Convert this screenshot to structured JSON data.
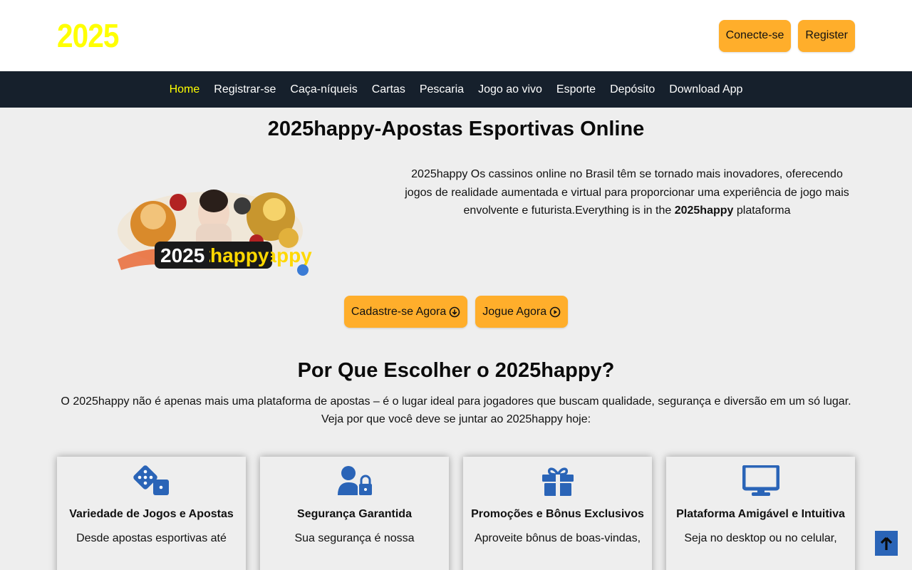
{
  "header": {
    "logo": "2025",
    "login_label": "Conecte-se",
    "register_label": "Register"
  },
  "nav": {
    "items": [
      "Home",
      "Registrar-se",
      "Caça-níqueis",
      "Cartas",
      "Pescaria",
      "Jogo ao vivo",
      "Esporte",
      "Depósito",
      "Download App"
    ]
  },
  "hero": {
    "title": "2025happy-Apostas Esportivas Online",
    "image_text": "2025happy",
    "text_before": "2025happy Os cassinos online no Brasil têm se tornado mais inovadores, oferecendo jogos de realidade aumentada e virtual para proporcionar uma experiência de jogo mais envolvente e futurista.Everything is in the ",
    "text_bold": "2025happy",
    "text_after": " plataforma",
    "cta_register": "Cadastre-se Agora",
    "cta_play": "Jogue Agora"
  },
  "why": {
    "title": "Por Que Escolher o 2025happy?",
    "text": "O 2025happy não é apenas mais uma plataforma de apostas – é o lugar ideal para jogadores que buscam qualidade, segurança e diversão em um só lugar. Veja por que você deve se juntar ao 2025happy hoje:"
  },
  "cards": [
    {
      "icon": "dice-icon",
      "title": "Variedade de Jogos e Apostas",
      "text": "Desde apostas esportivas até"
    },
    {
      "icon": "user-lock-icon",
      "title": "Segurança Garantida",
      "text": "Sua segurança é nossa"
    },
    {
      "icon": "gift-icon",
      "title": "Promoções e Bônus Exclusivos",
      "text": "Aproveite bônus de boas-vindas,"
    },
    {
      "icon": "desktop-icon",
      "title": "Plataforma Amigável e Intuitiva",
      "text": "Seja no desktop ou no celular,"
    }
  ],
  "colors": {
    "accent": "#ffae2b",
    "logo": "#ffff00",
    "nav_bg": "#16202c",
    "icon_blue": "#2a64b7"
  }
}
